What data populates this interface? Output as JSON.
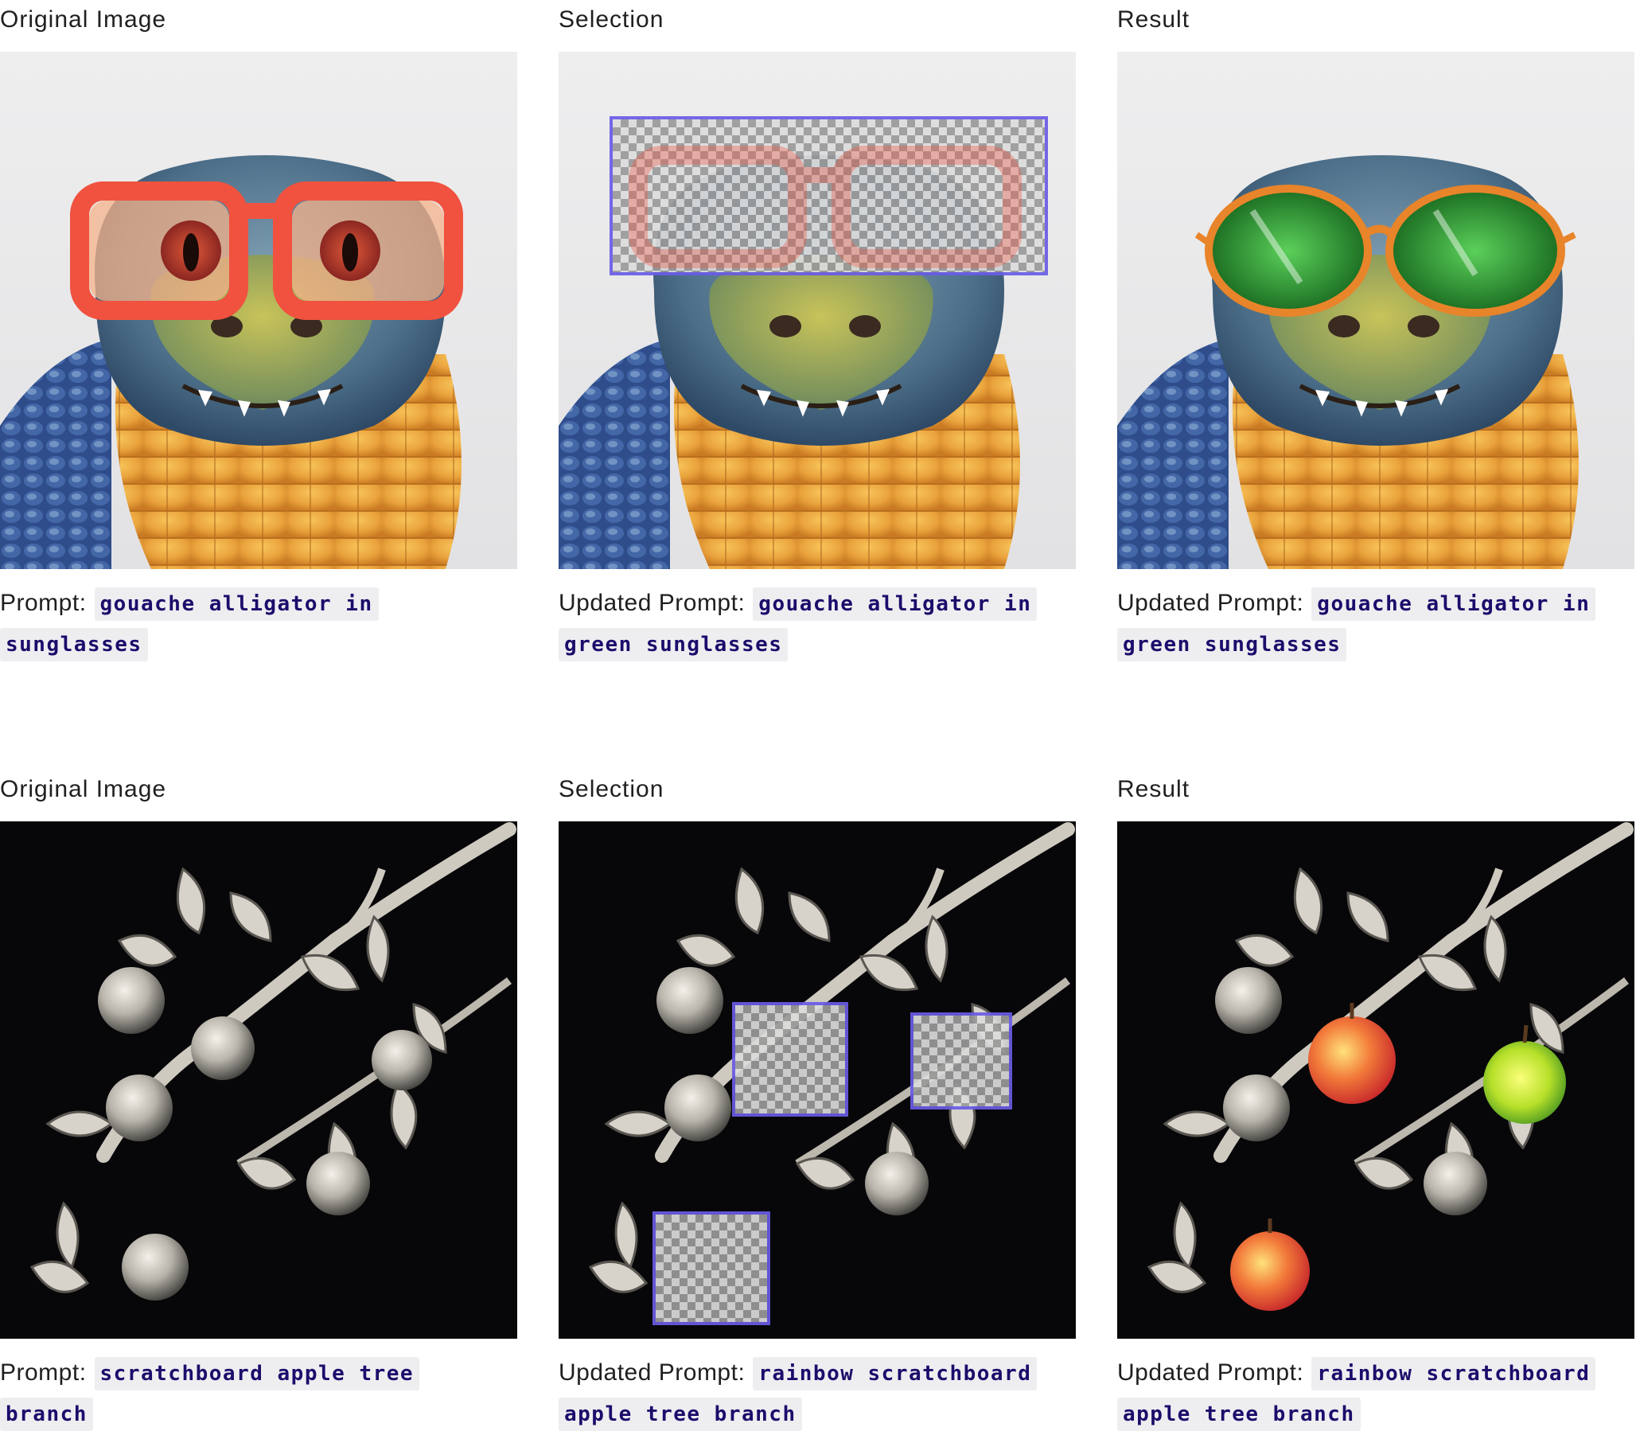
{
  "rows": [
    {
      "cells": [
        {
          "title": "Original Image",
          "prompt_label": "Prompt:",
          "prompt_code": "gouache alligator in sunglasses",
          "image_desc": "alligator with red-orange sunglasses"
        },
        {
          "title": "Selection",
          "prompt_label": "Updated Prompt:",
          "prompt_code": "gouache alligator in green sunglasses",
          "image_desc": "alligator with sunglasses region selected"
        },
        {
          "title": "Result",
          "prompt_label": "Updated Prompt:",
          "prompt_code": "gouache alligator in green sunglasses",
          "image_desc": "alligator with green sunglasses"
        }
      ]
    },
    {
      "cells": [
        {
          "title": "Original Image",
          "prompt_label": "Prompt:",
          "prompt_code": "scratchboard apple tree branch",
          "image_desc": "monochrome apple tree branch"
        },
        {
          "title": "Selection",
          "prompt_label": "Updated Prompt:",
          "prompt_code": "rainbow scratchboard apple tree branch",
          "image_desc": "apple branch with three apples selected"
        },
        {
          "title": "Result",
          "prompt_label": "Updated Prompt:",
          "prompt_code": "rainbow scratchboard apple tree branch",
          "image_desc": "apple branch with colored apples"
        }
      ]
    }
  ],
  "colors": {
    "selection_border": "#6a5ce6",
    "code_text": "#1b0d6b",
    "code_background": "#eeeef1",
    "sunglasses_original": "#f0523f",
    "sunglasses_result_lens": "#1f9a2c",
    "sunglasses_result_frame": "#e8842a",
    "apple_red": "#e0352b",
    "apple_green": "#7ac62b"
  }
}
